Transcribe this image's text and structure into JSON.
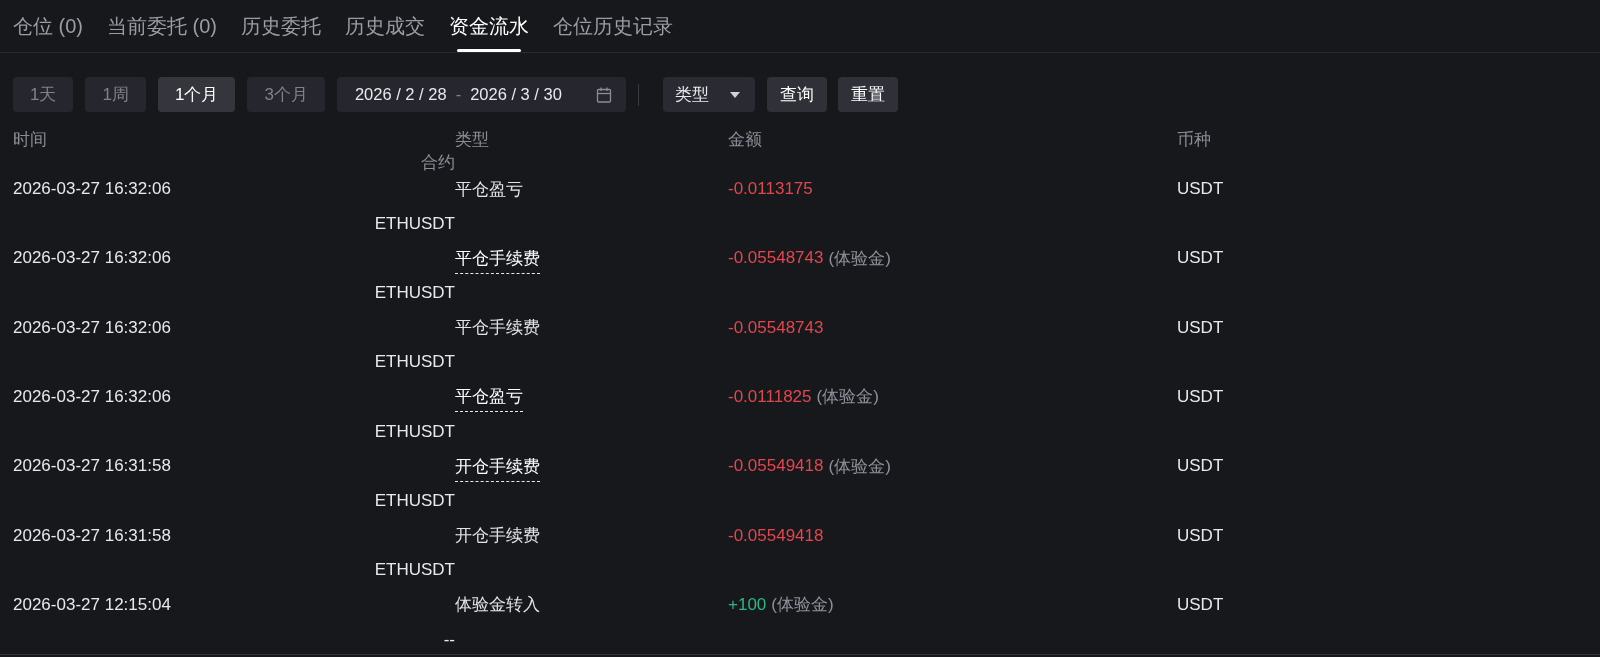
{
  "tabs": [
    {
      "label": "仓位 (0)",
      "selected": false
    },
    {
      "label": "当前委托 (0)",
      "selected": false
    },
    {
      "label": "历史委托",
      "selected": false
    },
    {
      "label": "历史成交",
      "selected": false
    },
    {
      "label": "资金流水",
      "selected": true
    },
    {
      "label": "仓位历史记录",
      "selected": false
    }
  ],
  "filters": {
    "periods": [
      {
        "label": "1天",
        "selected": false
      },
      {
        "label": "1周",
        "selected": false
      },
      {
        "label": "1个月",
        "selected": true
      },
      {
        "label": "3个月",
        "selected": false
      }
    ],
    "date_range": {
      "start": "2026 / 2 / 28",
      "separator": "-",
      "end": "2026 / 3 / 30"
    },
    "type_select": {
      "label": "类型"
    },
    "buttons": [
      "查询",
      "重置"
    ]
  },
  "table": {
    "columns": [
      "时间",
      "类型",
      "金额",
      "币种",
      "合约"
    ],
    "rows": [
      {
        "time": "2026-03-27 16:32:06",
        "type": "平仓盈亏",
        "hint": false,
        "amount": {
          "value": "-0.0113175",
          "kind": "debit"
        },
        "currency": "USDT",
        "contract": "ETHUSDT"
      },
      {
        "time": "2026-03-27 16:32:06",
        "type": "平仓手续费",
        "hint": true,
        "amount": {
          "value": "-0.05548743",
          "kind": "debit",
          "note": "(体验金)"
        },
        "currency": "USDT",
        "contract": "ETHUSDT"
      },
      {
        "time": "2026-03-27 16:32:06",
        "type": "平仓手续费",
        "hint": false,
        "amount": {
          "value": "-0.05548743",
          "kind": "debit"
        },
        "currency": "USDT",
        "contract": "ETHUSDT"
      },
      {
        "time": "2026-03-27 16:32:06",
        "type": "平仓盈亏",
        "hint": true,
        "amount": {
          "value": "-0.0111825",
          "kind": "debit",
          "note": "(体验金)"
        },
        "currency": "USDT",
        "contract": "ETHUSDT"
      },
      {
        "time": "2026-03-27 16:31:58",
        "type": "开仓手续费",
        "hint": true,
        "amount": {
          "value": "-0.05549418",
          "kind": "debit",
          "note": "(体验金)"
        },
        "currency": "USDT",
        "contract": "ETHUSDT"
      },
      {
        "time": "2026-03-27 16:31:58",
        "type": "开仓手续费",
        "hint": false,
        "amount": {
          "value": "-0.05549418",
          "kind": "debit"
        },
        "currency": "USDT",
        "contract": "ETHUSDT"
      },
      {
        "time": "2026-03-27 12:15:04",
        "type": "体验金转入",
        "hint": false,
        "amount": {
          "value": "+100",
          "kind": "credit",
          "note": "(体验金)"
        },
        "currency": "USDT",
        "contract": "--"
      }
    ]
  }
}
